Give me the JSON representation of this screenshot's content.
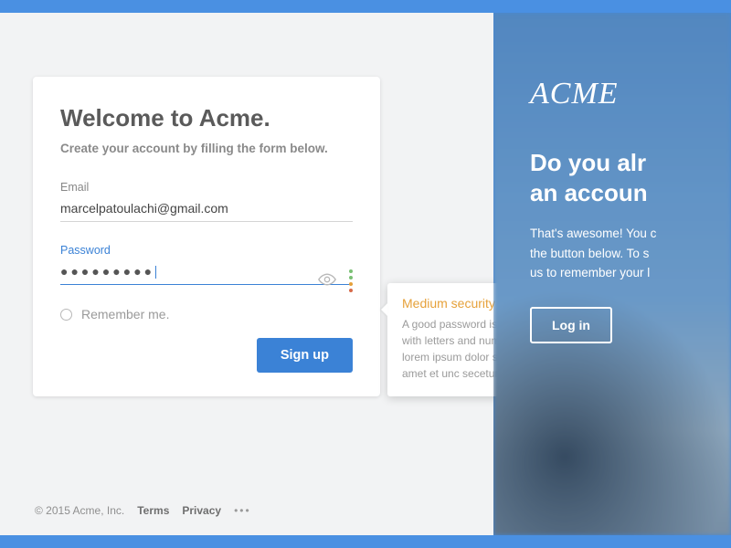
{
  "card": {
    "heading": "Welcome to Acme.",
    "subheading": "Create your account by filling the form below.",
    "email_label": "Email",
    "email_value": "marcelpatoulachi@gmail.com",
    "password_label": "Password",
    "password_masked": "●●●●●●●●●",
    "remember_label": "Remember me.",
    "signup_label": "Sign up"
  },
  "tooltip": {
    "title": "Medium security",
    "body": "A good password is a mix with letters and numbers, lorem ipsum dolor sit amet et unc secetur."
  },
  "right": {
    "brand": "ACME",
    "heading": "Do you alr\nan accoun",
    "body": "That's awesome! You c\nthe button below. To s\nus to remember your l",
    "login_label": "Log in"
  },
  "footer": {
    "copyright": "© 2015 Acme, Inc.",
    "terms": "Terms",
    "privacy": "Privacy"
  },
  "colors": {
    "accent": "#3b82d6",
    "warning": "#e6a13a"
  }
}
